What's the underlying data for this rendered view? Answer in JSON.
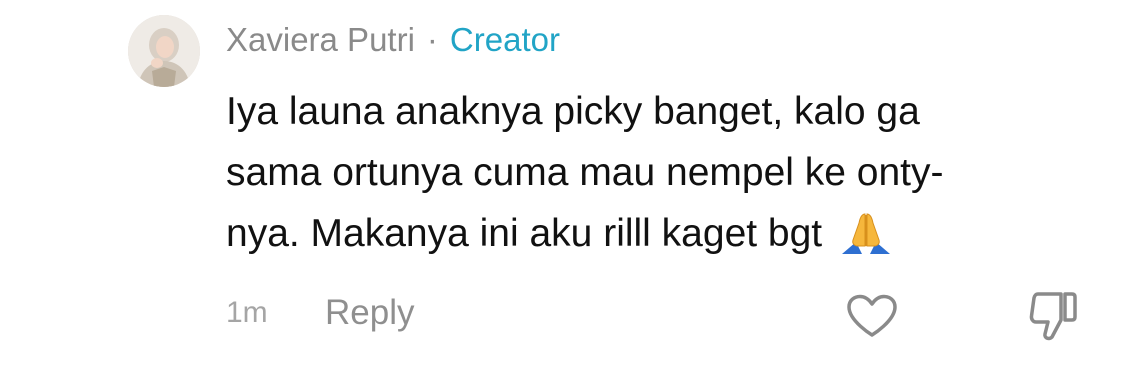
{
  "comment": {
    "author": "Xaviera Putri",
    "separator": "·",
    "badge": "Creator",
    "text_lines": [
      "Iya launa anaknya picky banget, kalo ga",
      "sama ortunya cuma mau nempel ke onty-",
      "nya. Makanya ini aku rilll kaget bgt"
    ],
    "emoji": "folded-hands",
    "time": "1m",
    "reply_label": "Reply",
    "actions": {
      "like_icon": "heart-outline-icon",
      "dislike_icon": "thumbs-down-outline-icon"
    }
  },
  "colors": {
    "author": "#8a8a8a",
    "badge": "#21a4c6",
    "text": "#111111",
    "meta": "#a5a5a5",
    "icon": "#8a8a8a"
  }
}
